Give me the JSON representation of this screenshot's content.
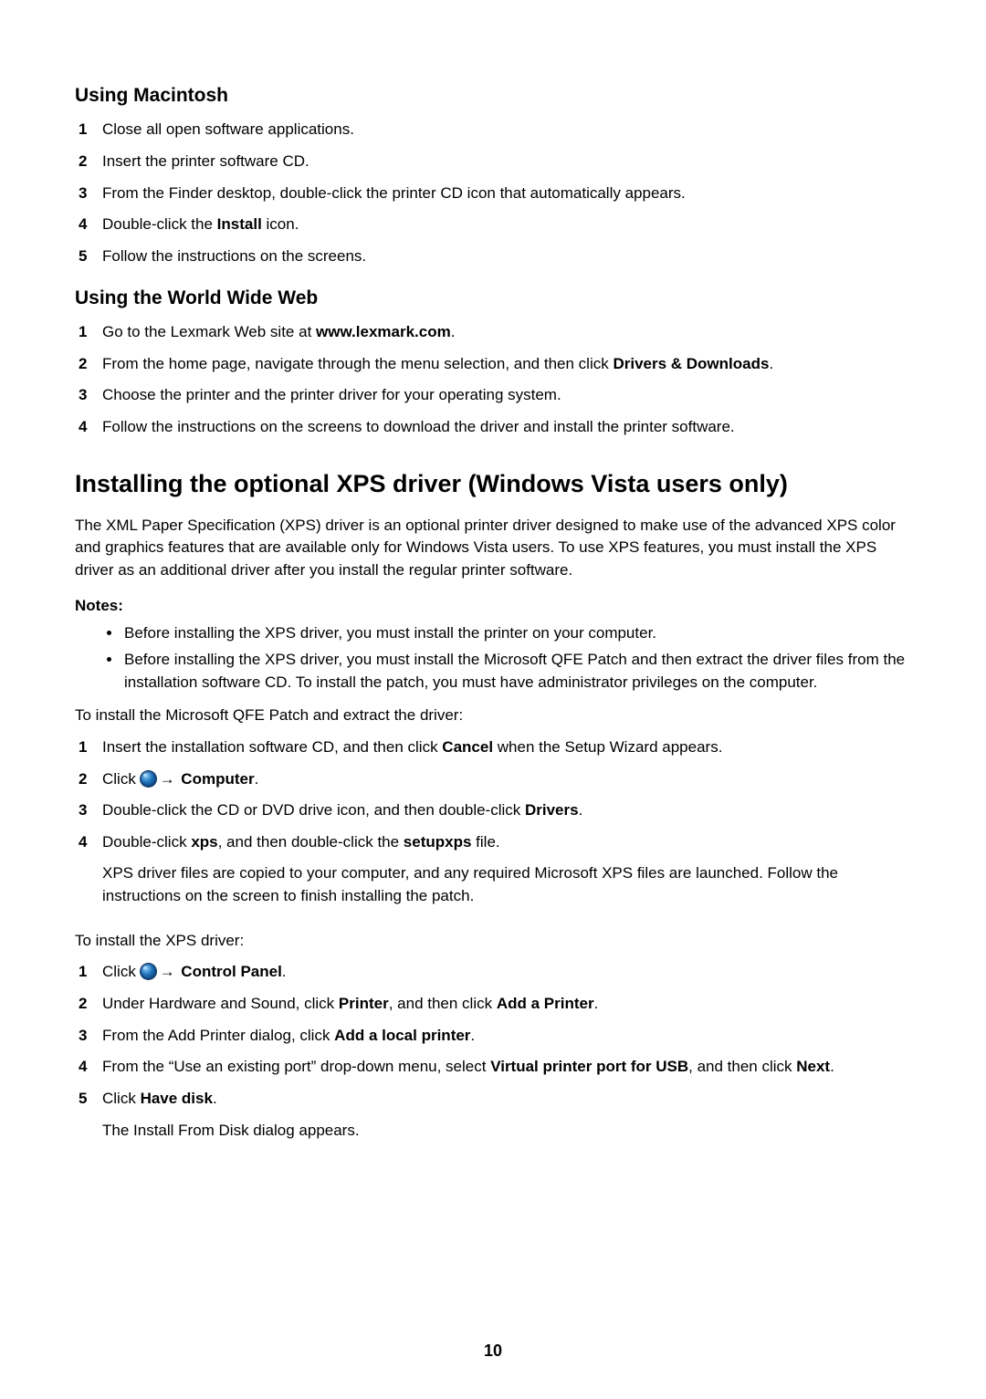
{
  "section_mac": {
    "heading": "Using Macintosh",
    "steps": [
      "Close all open software applications.",
      "Insert the printer software CD.",
      "From the Finder desktop, double-click the printer CD icon that automatically appears.",
      {
        "pre": "Double-click the ",
        "b": "Install",
        "post": " icon."
      },
      "Follow the instructions on the screens."
    ]
  },
  "section_www": {
    "heading": "Using the World Wide Web",
    "steps": [
      {
        "pre": "Go to the Lexmark Web site at ",
        "b": "www.lexmark.com",
        "post": "."
      },
      {
        "pre": "From the home page, navigate through the menu selection, and then click ",
        "b": "Drivers & Downloads",
        "post": "."
      },
      "Choose the printer and the printer driver for your operating system.",
      "Follow the instructions on the screens to download the driver and install the printer software."
    ]
  },
  "xps": {
    "heading": "Installing the optional XPS driver (Windows Vista users only)",
    "intro": "The XML Paper Specification (XPS) driver is an optional printer driver designed to make use of the advanced XPS color and graphics features that are available only for Windows Vista users. To use XPS features, you must install the XPS driver as an additional driver after you install the regular printer software.",
    "notes_label": "Notes:",
    "notes": [
      "Before installing the XPS driver, you must install the printer on your computer.",
      "Before installing the XPS driver, you must install the Microsoft QFE Patch and then extract the driver files from the installation software CD. To install the patch, you must have administrator privileges on the computer."
    ],
    "qfe_intro": "To install the Microsoft QFE Patch and extract the driver:",
    "qfe_steps": {
      "s1": {
        "pre": "Insert the installation software CD, and then click ",
        "b": "Cancel",
        "post": " when the Setup Wizard appears."
      },
      "s2": {
        "pre": "Click ",
        "arrow": "→",
        "b": " Computer",
        "post": "."
      },
      "s3": {
        "pre": "Double-click the CD or DVD drive icon, and then double-click ",
        "b": "Drivers",
        "post": "."
      },
      "s4": {
        "pre": "Double-click ",
        "b1": "xps",
        "mid": ", and then double-click the ",
        "b2": "setupxps",
        "post": " file.",
        "after": "XPS driver files are copied to your computer, and any required Microsoft XPS files are launched. Follow the instructions on the screen to finish installing the patch."
      }
    },
    "driver_intro": "To install the XPS driver:",
    "driver_steps": {
      "s1": {
        "pre": "Click ",
        "arrow": "→",
        "b": " Control Panel",
        "post": "."
      },
      "s2": {
        "pre": "Under Hardware and Sound, click ",
        "b1": "Printer",
        "mid": ", and then click ",
        "b2": "Add a Printer",
        "post": "."
      },
      "s3": {
        "pre": "From the Add Printer dialog, click ",
        "b": "Add a local printer",
        "post": "."
      },
      "s4": {
        "pre": "From the “Use an existing port” drop-down menu, select ",
        "b1": "Virtual printer port for USB",
        "mid": ", and then click ",
        "b2": "Next",
        "post": "."
      },
      "s5": {
        "pre": "Click ",
        "b": "Have disk",
        "post": ".",
        "after": "The Install From Disk dialog appears."
      }
    }
  },
  "page_number": "10"
}
